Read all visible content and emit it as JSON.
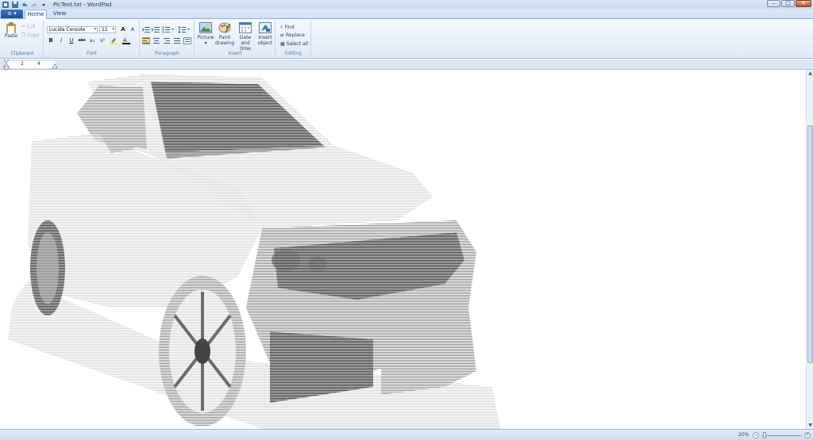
{
  "window": {
    "title": "PicText.txt - WordPad",
    "buttons": {
      "minimize": "–",
      "maximize": "□",
      "close": "✕"
    }
  },
  "quick_access": [
    "save-icon",
    "undo-icon",
    "redo-icon",
    "customize-icon"
  ],
  "app_menu_glyph": "≡ ▾",
  "tabs": [
    {
      "label": "Home",
      "active": true
    },
    {
      "label": "View",
      "active": false
    }
  ],
  "ribbon": {
    "clipboard": {
      "label": "Clipboard",
      "paste": "Paste",
      "cut": "Cut",
      "copy": "Copy"
    },
    "font": {
      "label": "Font",
      "family": "Lucida Console",
      "size": "11",
      "bold": "B",
      "italic": "I",
      "underline": "U",
      "strike": "abc",
      "subscript": "x₂",
      "superscript": "x²",
      "grow": "A",
      "shrink": "A"
    },
    "paragraph": {
      "label": "Paragraph"
    },
    "insert": {
      "label": "Insert",
      "picture": "Picture",
      "paint_1": "Paint",
      "paint_2": "drawing",
      "date_1": "Date and",
      "date_2": "time",
      "object_1": "Insert",
      "object_2": "object"
    },
    "editing": {
      "label": "Editing",
      "find": "Find",
      "replace": "Replace",
      "select_all": "Select all"
    }
  },
  "ruler": {
    "marks": [
      "2",
      "4"
    ]
  },
  "statusbar": {
    "zoom": "20%",
    "zoom_fraction": 0.06
  },
  "colors": {
    "accent": "#1c4f9c",
    "ribbon_bg": "#f5f9fe",
    "highlight": "#f6c35a",
    "document": "#ffffff"
  }
}
